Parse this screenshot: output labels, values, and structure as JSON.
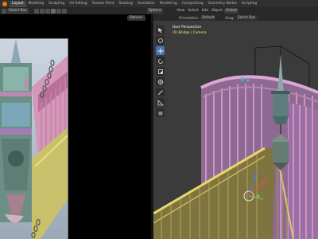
{
  "topbar": {
    "workspaces": [
      "Layout",
      "Modeling",
      "Sculpting",
      "UV Editing",
      "Texture Paint",
      "Shading",
      "Animation",
      "Rendering",
      "Compositing",
      "Geometry Nodes",
      "Scripting"
    ],
    "active": "Layout"
  },
  "header": {
    "select_box": "Select Box",
    "view": "View",
    "select": "Select",
    "add": "Add",
    "object": "Object",
    "global": "Global",
    "options": "Options",
    "orientation_label": "Orientation:",
    "orientation_value": "Default",
    "drag_label": "Drag:",
    "drag_value": "Select Box"
  },
  "right_viewport": {
    "view_name": "User Perspective",
    "collection": "(0) Bridge | Camera"
  },
  "left_viewport": {
    "options": "Options"
  },
  "colors": {
    "accent": "#4772b3",
    "logo": "#e87d0d",
    "overlay_sub": "#ffe56a"
  },
  "icons": [
    "blender-logo-icon",
    "cursor-icon",
    "move-icon",
    "rotate-icon",
    "scale-icon",
    "transform-icon",
    "annotate-icon",
    "measure-icon",
    "add-cube-icon"
  ]
}
